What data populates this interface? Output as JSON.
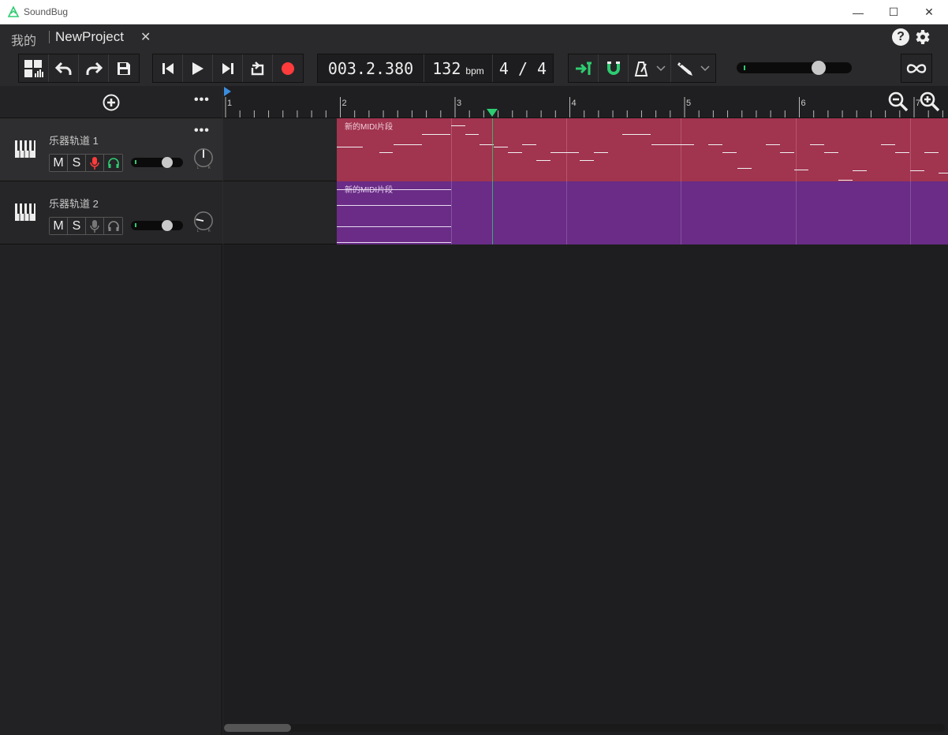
{
  "window": {
    "title": "SoundBug",
    "controls": {
      "minimize": "—",
      "maximize": "☐",
      "close": "✕"
    }
  },
  "tabs": {
    "home_label": "我的",
    "project_label": "NewProject",
    "close_glyph": "✕"
  },
  "header_icons": {
    "help": "?"
  },
  "transport": {
    "position": "003.2.380",
    "tempo": "132",
    "tempo_unit": "bpm",
    "time_signature": "4 / 4"
  },
  "colors": {
    "accent_green": "#2ecc71",
    "record_red": "#ff3b3b",
    "clip_track1": "#a1344f",
    "clip_track2": "#6a2c87",
    "playhead_marker": "#2ecc71",
    "loop_start_marker": "#3a8dde"
  },
  "ruler": {
    "bar_labels": [
      "1",
      "2",
      "3",
      "4",
      "5",
      "6",
      "7"
    ]
  },
  "tracks": [
    {
      "name": "乐器轨道 1",
      "mute_label": "M",
      "solo_label": "S",
      "record_armed": true,
      "monitor_on": true,
      "clip_label": "新的MIDI片段"
    },
    {
      "name": "乐器轨道 2",
      "mute_label": "M",
      "solo_label": "S",
      "record_armed": false,
      "monitor_on": false,
      "clip_label": "新的MIDI片段"
    }
  ]
}
